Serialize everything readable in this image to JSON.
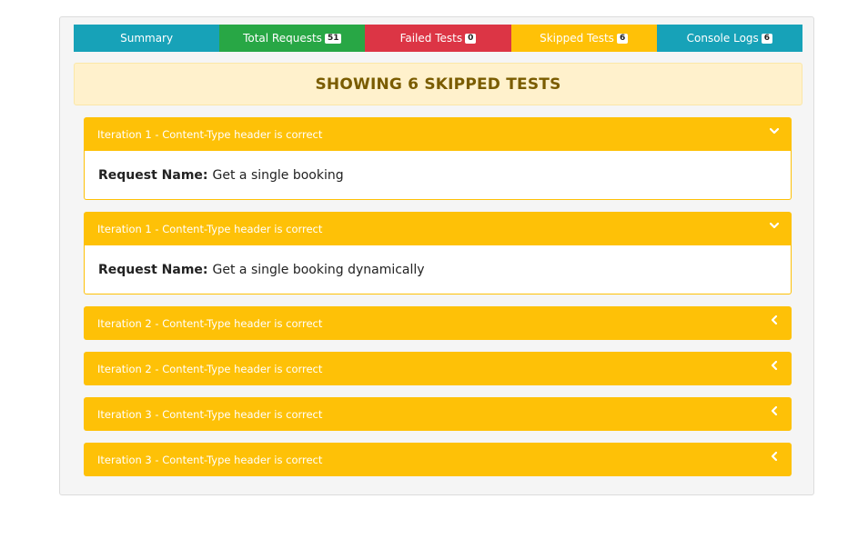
{
  "tabs": [
    {
      "label": "Summary",
      "badge": null,
      "color": "#17a2b8"
    },
    {
      "label": "Total Requests",
      "badge": "51",
      "color": "#28a745"
    },
    {
      "label": "Failed Tests",
      "badge": "0",
      "color": "#dc3545"
    },
    {
      "label": "Skipped Tests",
      "badge": "6",
      "color": "#ffc107"
    },
    {
      "label": "Console Logs",
      "badge": "6",
      "color": "#17a2b8"
    }
  ],
  "banner": {
    "title": "SHOWING 6 SKIPPED TESTS"
  },
  "request_name_label": "Request Name:",
  "items": [
    {
      "title": "Iteration 1 - Content-Type header is correct",
      "expanded": true,
      "request_name": "Get a single booking",
      "icon": "chevron-down-icon"
    },
    {
      "title": "Iteration 1 - Content-Type header is correct",
      "expanded": true,
      "request_name": "Get a single booking dynamically",
      "icon": "chevron-down-icon"
    },
    {
      "title": "Iteration 2 - Content-Type header is correct",
      "expanded": false,
      "icon": "chevron-left-icon"
    },
    {
      "title": "Iteration 2 - Content-Type header is correct",
      "expanded": false,
      "icon": "chevron-left-icon"
    },
    {
      "title": "Iteration 3 - Content-Type header is correct",
      "expanded": false,
      "icon": "chevron-left-icon"
    },
    {
      "title": "Iteration 3 - Content-Type header is correct",
      "expanded": false,
      "icon": "chevron-left-icon"
    }
  ],
  "colors": {
    "accordion": "#fec107",
    "banner_bg": "#fff1cc",
    "banner_text": "#7a5c00"
  }
}
